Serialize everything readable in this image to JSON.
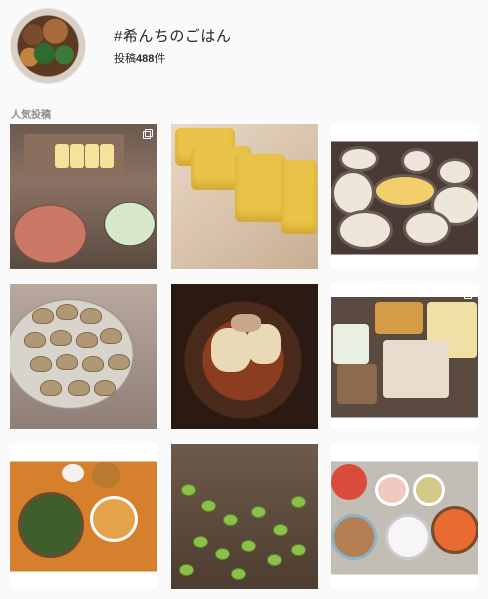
{
  "tag": {
    "title": "#希んちのごはん",
    "count_prefix": "投稿",
    "count": "488",
    "count_suffix": "件"
  },
  "section": {
    "label": "人気投稿"
  },
  "colors": {
    "background": "#fafafa",
    "muted_text": "#8e8e8e"
  }
}
